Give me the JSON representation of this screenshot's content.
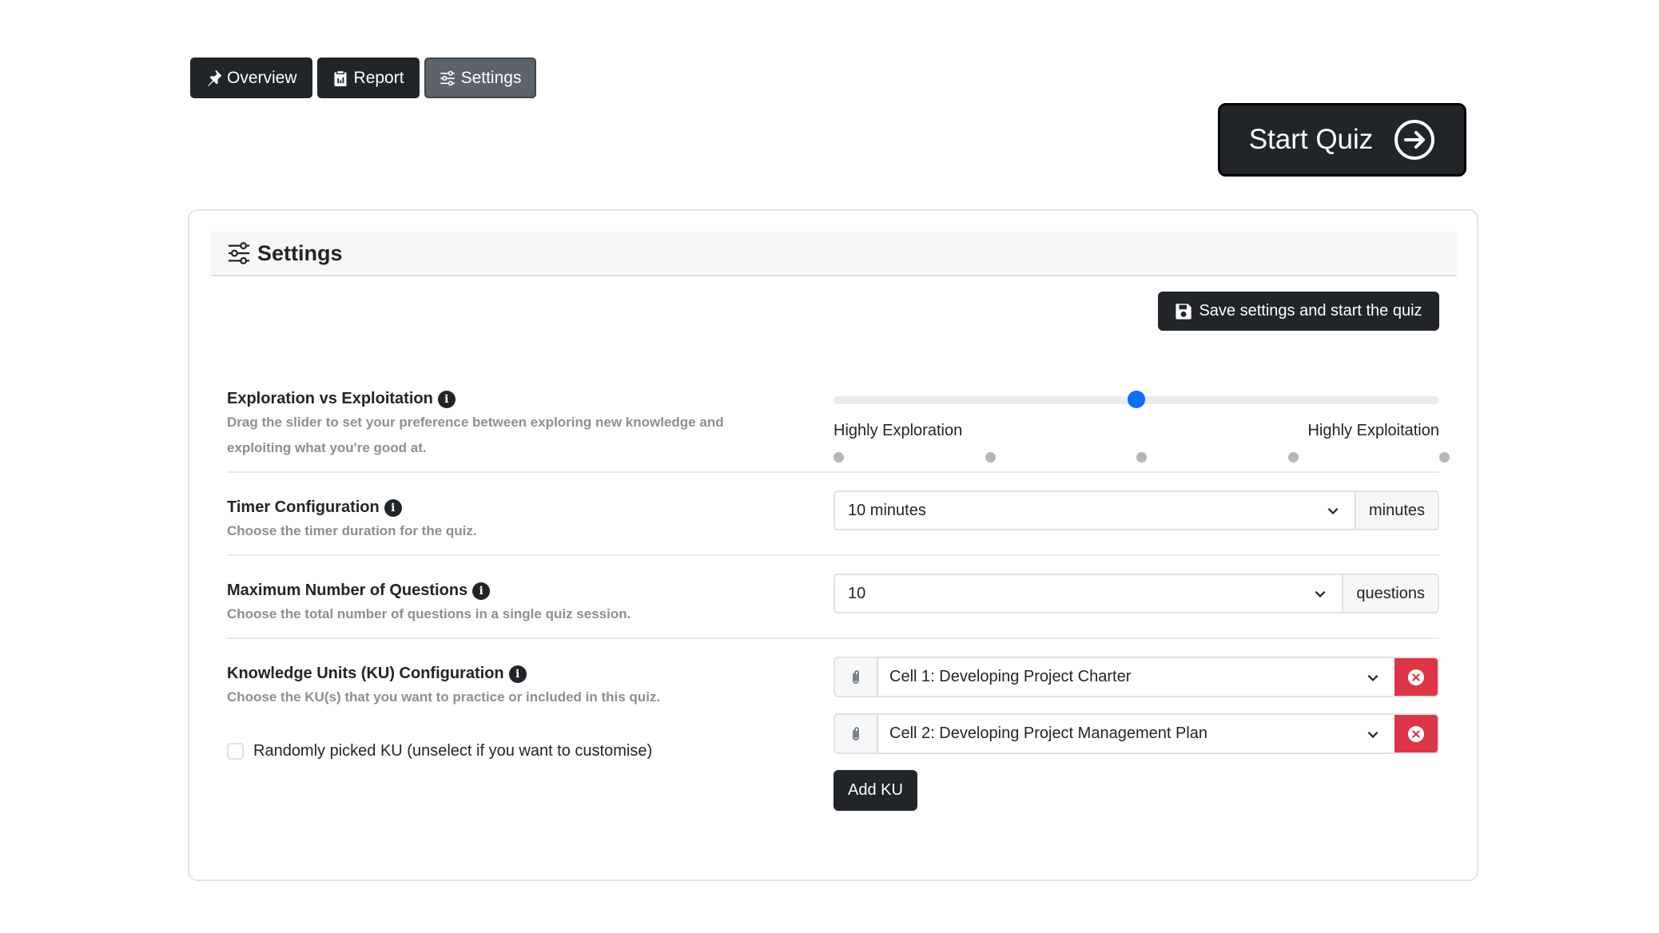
{
  "nav": {
    "tabs": [
      {
        "label": "Overview",
        "icon": "pin-icon"
      },
      {
        "label": "Report",
        "icon": "clipboard-icon"
      },
      {
        "label": "Settings",
        "icon": "sliders-icon",
        "active": true
      }
    ]
  },
  "start_quiz": {
    "label": "Start Quiz",
    "icon": "arrow-right-circle-icon"
  },
  "settings": {
    "title": "Settings",
    "save_label": "Save settings and start the quiz",
    "exploration": {
      "label": "Exploration vs Exploitation",
      "description_line1": "Drag the slider to set your preference between exploring new knowledge and",
      "description_line2": "exploiting what you're good at.",
      "left_label": "Highly Exploration",
      "right_label": "Highly Exploitation",
      "value": 0.5,
      "steps": 5
    },
    "timer": {
      "label": "Timer Configuration",
      "description": "Choose the timer duration for the quiz.",
      "value": "10 minutes",
      "unit": "minutes"
    },
    "max_questions": {
      "label": "Maximum Number of Questions",
      "description": "Choose the total number of questions in a single quiz session.",
      "value": "10",
      "unit": "questions"
    },
    "ku": {
      "label": "Knowledge Units (KU) Configuration",
      "description": "Choose the KU(s) that you want to practice or included in this quiz.",
      "random_label": "Randomly picked KU (unselect if you want to customise)",
      "random_checked": false,
      "items": [
        "Cell 1: Developing Project Charter",
        "Cell 2: Developing Project Management Plan"
      ],
      "add_label": "Add KU"
    }
  },
  "colors": {
    "primary_dark": "#212529",
    "accent_blue": "#0d6efd",
    "danger": "#dc3545"
  }
}
